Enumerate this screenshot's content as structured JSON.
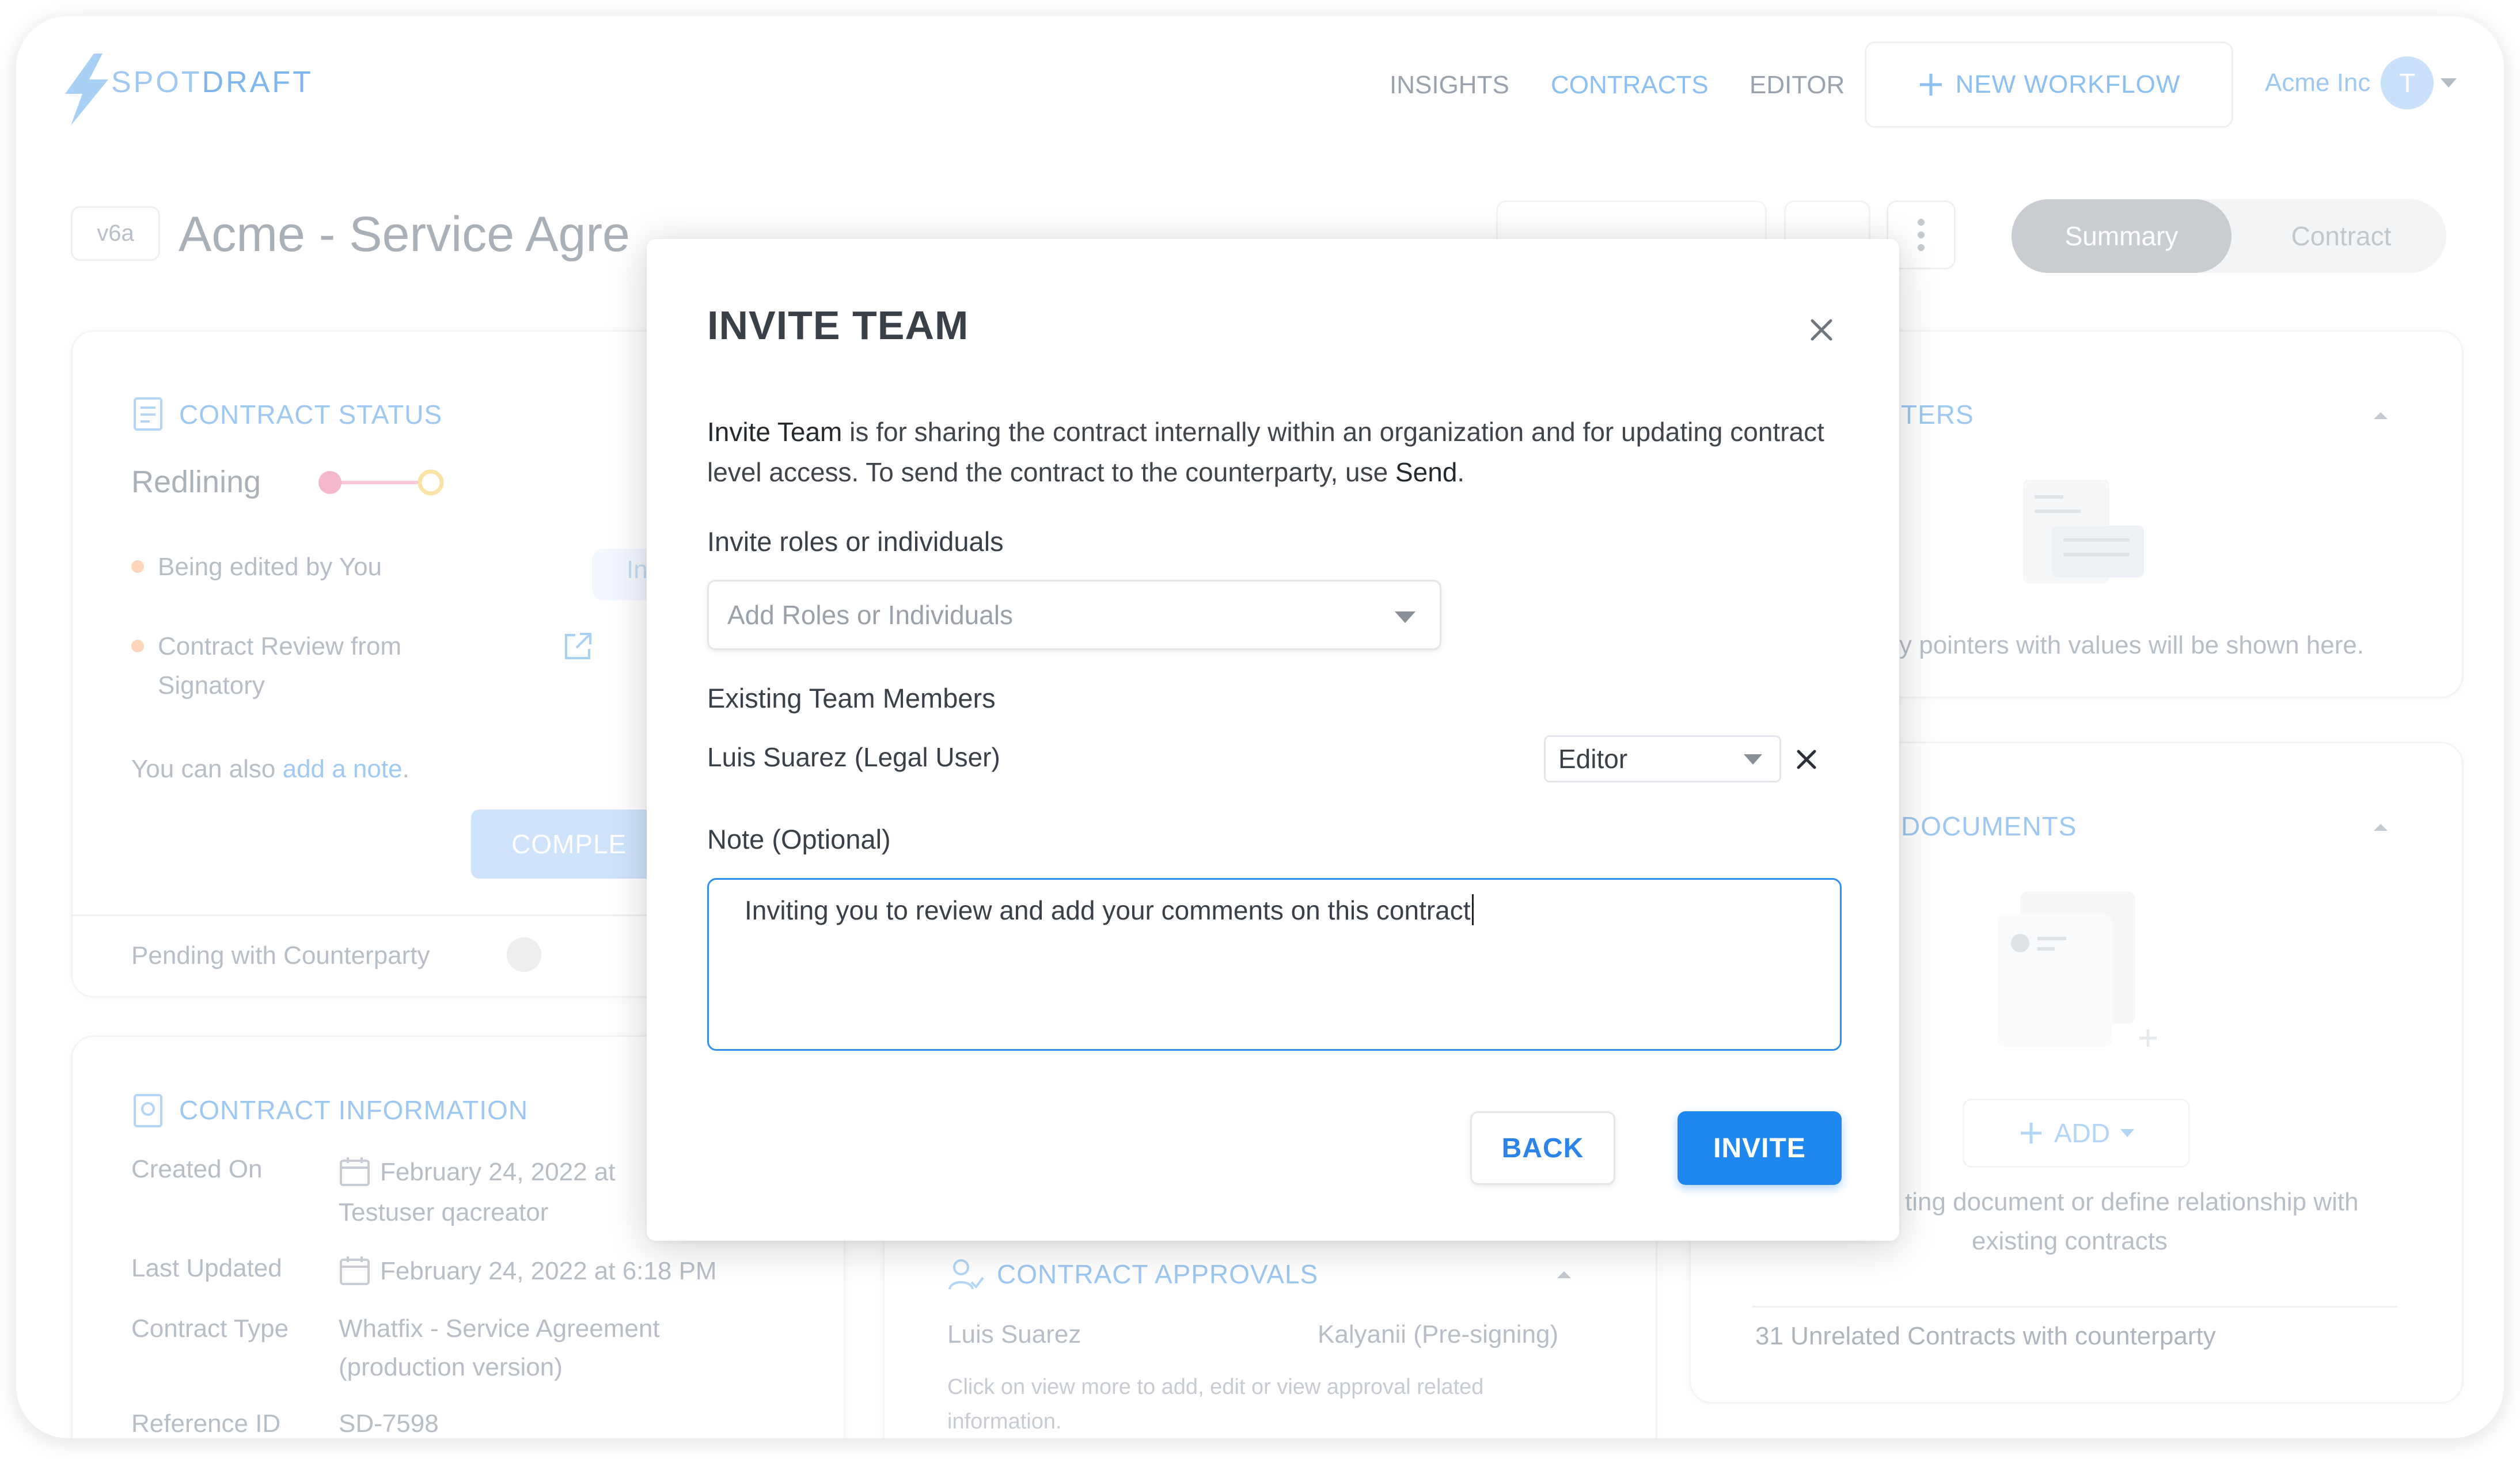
{
  "brand": {
    "logo_light": "SPOT",
    "logo_bold": "DRAFT"
  },
  "nav": {
    "insights": "INSIGHTS",
    "contracts": "CONTRACTS",
    "editor": "EDITOR",
    "new_workflow": "NEW WORKFLOW",
    "org_name": "Acme Inc",
    "avatar_initial": "T"
  },
  "header": {
    "version": "v6a",
    "title": "Acme - Service Agre",
    "tabs": {
      "summary": "Summary",
      "contract": "Contract"
    }
  },
  "contract_status": {
    "title": "CONTRACT STATUS",
    "stage": "Redlining",
    "items": [
      "Being edited by You",
      "Contract Review from",
      "Signatory"
    ],
    "badge_fragment": "In",
    "note_prefix": "You can also ",
    "note_link": "add a note",
    "note_suffix": ".",
    "complete_button": "COMPLE",
    "pending": "Pending with Counterparty"
  },
  "contract_info": {
    "title": "CONTRACT INFORMATION",
    "created_label": "Created On",
    "created_value": "February 24, 2022 at",
    "created_by": "Testuser qacreator",
    "updated_label": "Last Updated",
    "updated_value": "February 24, 2022 at 6:18 PM",
    "type_label": "Contract Type",
    "type_value_1": "Whatfix - Service Agreement",
    "type_value_2": "(production version)",
    "ref_label": "Reference ID",
    "ref_value": "SD-7598"
  },
  "contract_approvals": {
    "title": "CONTRACT APPROVALS",
    "approver": "Luis Suarez",
    "approver_2": "Kalyanii (Pre-signing)",
    "hint_1": "Click on view more to add, edit or view approval related",
    "hint_2": "information."
  },
  "pointers": {
    "title": "INTERS",
    "empty": "y pointers with values will be shown here."
  },
  "documents": {
    "title": "D DOCUMENTS",
    "add_button": "ADD",
    "hint_1": "ting document or define relationship with",
    "hint_2": "existing contracts",
    "unrelated": "31 Unrelated Contracts with counterparty"
  },
  "modal": {
    "title": "INVITE TEAM",
    "desc_strong_1": "Invite Team",
    "desc_mid": " is for sharing the contract internally within an organization and for updating contract level access. To send the contract to the counterparty, use ",
    "desc_strong_2": "Send",
    "desc_end": ".",
    "roles_label": "Invite roles or individuals",
    "roles_placeholder": "Add Roles or Individuals",
    "existing_label": "Existing Team Members",
    "member_name": "Luis Suarez (Legal User)",
    "member_role": "Editor",
    "note_label": "Note (Optional)",
    "note_value": "Inviting you to review and add your comments on this contract",
    "back_button": "BACK",
    "invite_button": "INVITE"
  },
  "icons": {
    "close": "close-icon",
    "remove": "close-icon",
    "caret": "chevron-down-icon",
    "plus": "plus-icon",
    "external": "external-link-icon",
    "calendar": "calendar-icon",
    "kebab": "more-vertical-icon"
  },
  "colors": {
    "primary": "#1e88f0",
    "focus_border": "#2f8df0"
  }
}
